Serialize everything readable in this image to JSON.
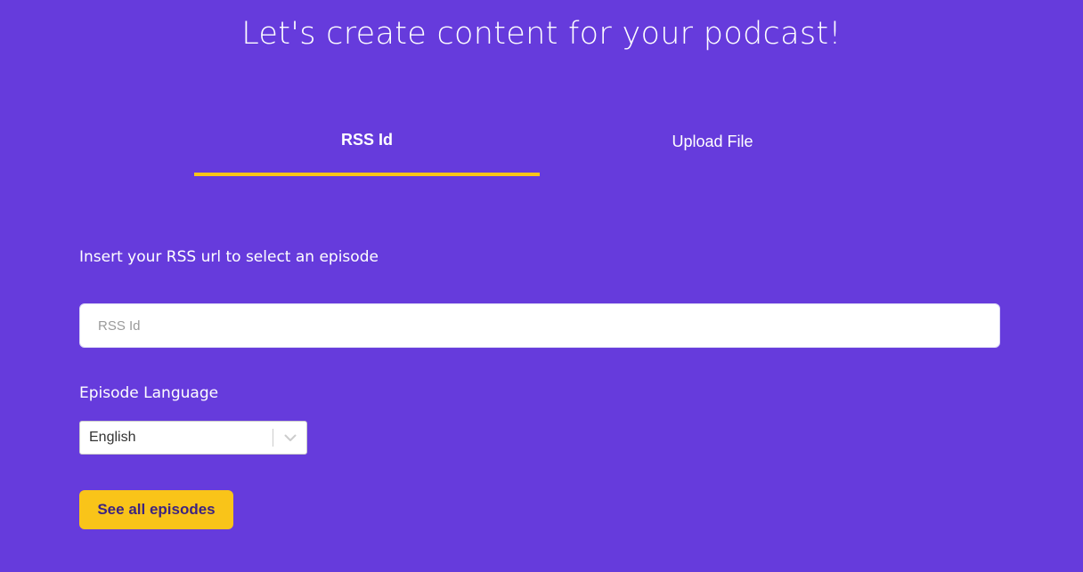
{
  "page": {
    "title": "Let's create content for your podcast!"
  },
  "tabs": [
    {
      "label": "RSS Id",
      "active": true
    },
    {
      "label": "Upload File",
      "active": false
    }
  ],
  "rss": {
    "label": "Insert your RSS url to select an episode",
    "placeholder": "RSS Id",
    "value": ""
  },
  "language": {
    "label": "Episode Language",
    "selected": "English",
    "icon": "chevron-down-icon"
  },
  "actions": {
    "see_all_label": "See all episodes"
  },
  "colors": {
    "background": "#663bdc",
    "accent": "#f9c419",
    "button_text": "#3d2480"
  }
}
